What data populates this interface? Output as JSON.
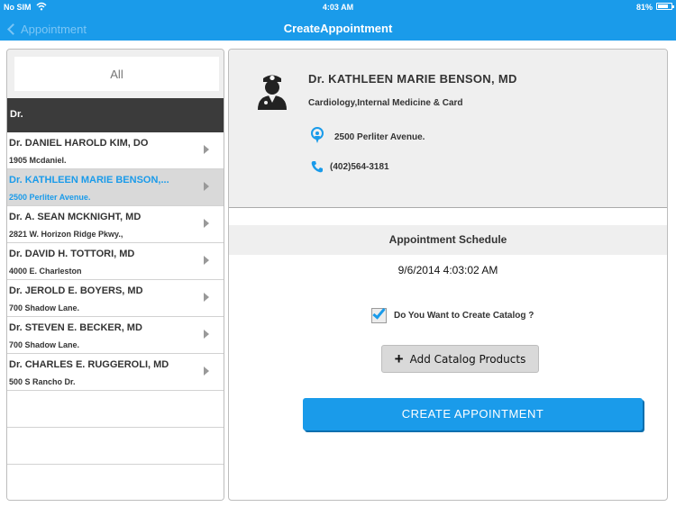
{
  "status_bar": {
    "carrier": "No SIM",
    "time": "4:03 AM",
    "battery": "81%",
    "battery_level": 0.81
  },
  "nav": {
    "back_label": "Appointment",
    "title": "CreateAppointment"
  },
  "sidebar": {
    "search_placeholder": "All",
    "section_header": "Dr.",
    "items": [
      {
        "name": "Dr. DANIEL HAROLD KIM, DO",
        "address": "1905 Mcdaniel."
      },
      {
        "name": "Dr. KATHLEEN MARIE BENSON,...",
        "address": "2500 Perliter Avenue."
      },
      {
        "name": "Dr. A. SEAN MCKNIGHT, MD",
        "address": "2821 W. Horizon Ridge Pkwy.,"
      },
      {
        "name": "Dr. DAVID H. TOTTORI, MD",
        "address": "4000 E. Charleston"
      },
      {
        "name": "Dr. JEROLD E. BOYERS, MD",
        "address": "700 Shadow Lane."
      },
      {
        "name": "Dr. STEVEN E. BECKER, MD",
        "address": "700 Shadow Lane."
      },
      {
        "name": "Dr. CHARLES E. RUGGEROLI, MD",
        "address": "500 S Rancho Dr."
      }
    ],
    "selected_index": 1
  },
  "doctor": {
    "name": "Dr. KATHLEEN MARIE BENSON, MD",
    "specialty": "Cardiology,Internal Medicine & Card",
    "address": "2500 Perliter Avenue.",
    "phone": "(402)564-3181"
  },
  "schedule": {
    "header": "Appointment Schedule",
    "datetime": "9/6/2014 4:03:02 AM"
  },
  "catalog": {
    "checkbox_label": "Do You Want to Create Catalog ?",
    "checked": true,
    "add_button_label": "Add Catalog Products"
  },
  "create_button_label": "CREATE APPOINTMENT",
  "colors": {
    "accent": "#1a9bea",
    "selected_row": "#d9d9d9",
    "section_header": "#3b3b3b"
  }
}
